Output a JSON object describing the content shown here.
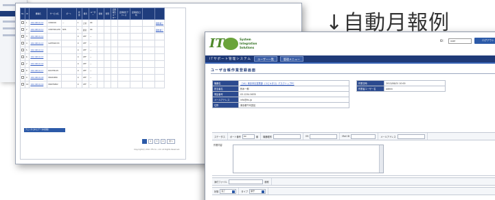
{
  "caption": "↓自動月報例",
  "list_screen": {
    "headers": [
      "No",
      "ID",
      "機種名",
      "サービス名",
      "ポート",
      "状態",
      "備考",
      "ユーザー",
      "稼動",
      "管理",
      "定期報告ユーザー",
      "定期報告アドレス",
      "定期報告日時",
      "",
      ""
    ],
    "rows": [
      {
        "no": "1",
        "id": "192.168.10.10",
        "model": "CONDOR",
        "svc": "—",
        "port": "1",
        "state": "正常",
        "note": "OK",
        "a1": "開始/終了",
        "a2": "送信"
      },
      {
        "no": "2",
        "id": "192.168.10.11",
        "model": "CONTROLLER",
        "svc": "SMS",
        "port": "1",
        "state": "異常",
        "note": "OK",
        "a1": "開始/終了",
        "a2": "送信"
      },
      {
        "no": "3",
        "id": "192.168.10.12",
        "model": "",
        "svc": "",
        "port": "0",
        "state": "OFF",
        "note": "—",
        "a1": "",
        "a2": ""
      },
      {
        "no": "4",
        "id": "192.168.10.13",
        "model": "GATEWAY-PC",
        "svc": "",
        "port": "0",
        "state": "OFF",
        "note": "—",
        "a1": "",
        "a2": ""
      },
      {
        "no": "5",
        "id": "192.168.10.14",
        "model": "",
        "svc": "",
        "port": "0",
        "state": "OFF",
        "note": "—",
        "a1": "",
        "a2": ""
      },
      {
        "no": "6",
        "id": "192.168.10.15",
        "model": "",
        "svc": "",
        "port": "0",
        "state": "OFF",
        "note": "—",
        "a1": "",
        "a2": ""
      },
      {
        "no": "7",
        "id": "192.168.10.16",
        "model": "",
        "svc": "",
        "port": "0",
        "state": "OFF",
        "note": "—",
        "a1": "",
        "a2": ""
      },
      {
        "no": "8",
        "id": "192.168.10.17",
        "model": "ROUTER-PC",
        "svc": "",
        "port": "0",
        "state": "OFF",
        "note": "—",
        "a1": "",
        "a2": ""
      },
      {
        "no": "9",
        "id": "192.168.10.18",
        "model": "PROXSERV",
        "svc": "",
        "port": "0",
        "state": "OFF",
        "note": "—",
        "a1": "",
        "a2": ""
      },
      {
        "no": "10",
        "id": "192.168.10.19",
        "model": "PRINTSERV",
        "svc": "",
        "port": "0",
        "state": "OFF",
        "note": "—",
        "a1": "",
        "a2": ""
      }
    ],
    "bulk_button": "チェックされたデータを削除",
    "pager": [
      "1",
      "2",
      "3",
      "4",
      "次へ"
    ],
    "footer": "Copyright(C) 2011 ITS Co., Ltd. All Rights Reserved."
  },
  "form_screen": {
    "logo_letters": "IT",
    "logo_lines": [
      "System",
      "Integration",
      "Solutions"
    ],
    "id_label": "ID：",
    "id_value": "user",
    "logout": "ログアウト",
    "nav_title": "ITサポート管理システム",
    "nav_tabs": [
      "ユーザー一覧",
      "管理メニュー"
    ],
    "page_title": "ユーザ台帳作業登録画面",
    "left_grid": [
      {
        "label": "機器名",
        "value": "［1A］東京本社営業部（ユビキタス）デスクトップPC",
        "link": true
      },
      {
        "label": "担当者名",
        "value": "鈴木一郎",
        "link": false
      },
      {
        "label": "電話番号",
        "value": "03-1234-5678",
        "link": false
      },
      {
        "label": "メールアドレス",
        "value": "info@its.jp",
        "link": false
      },
      {
        "label": "住所",
        "value": "東京都千代田区",
        "link": false
      }
    ],
    "right_grid": [
      {
        "label": "作業日時",
        "value": "2012/08/01 10:00"
      },
      {
        "label": "作業者ユーザー名",
        "value": "admin"
      }
    ],
    "row1": {
      "a": "ステータス",
      "b": "ポート番号",
      "b_val": "80",
      "b_unit": "番",
      "c": "機器種別",
      "d": "OS",
      "e": "Mail ID",
      "f": "メールアドレス"
    },
    "memo_label": "作業内容",
    "row2": {
      "a": "添付ファイル",
      "b": "参照"
    },
    "row3": {
      "a": "状態",
      "a_val": "完了",
      "b": "タイプ",
      "b_val": "保守"
    }
  }
}
